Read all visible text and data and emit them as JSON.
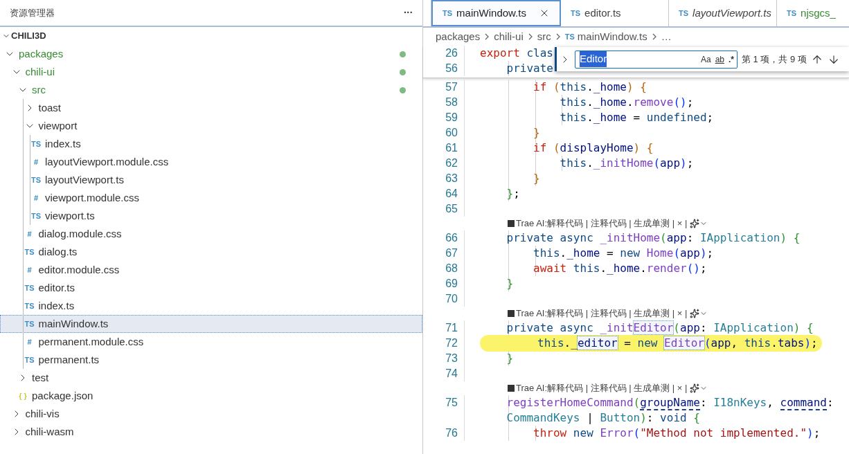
{
  "sidebar": {
    "title": "资源管理器",
    "more": "···",
    "root": {
      "name": "CHILI3D",
      "expanded": true
    },
    "tree": [
      {
        "name": "packages",
        "kind": "folder",
        "expanded": true,
        "untracked": true,
        "children": [
          {
            "name": "chili-ui",
            "kind": "folder",
            "expanded": true,
            "untracked": true,
            "children": [
              {
                "name": "src",
                "kind": "folder",
                "expanded": true,
                "untracked": true,
                "children": [
                  {
                    "name": "toast",
                    "kind": "folder",
                    "expanded": false,
                    "untracked": false
                  },
                  {
                    "name": "viewport",
                    "kind": "folder",
                    "expanded": true,
                    "untracked": false,
                    "children": [
                      {
                        "name": "index.ts",
                        "kind": "file",
                        "color": "#3f8fc4",
                        "icon": "TS",
                        "selected": false
                      },
                      {
                        "name": "layoutViewport.module.css",
                        "kind": "file",
                        "color": "#3f8fc4",
                        "icon": "#",
                        "selected": false
                      },
                      {
                        "name": "layoutViewport.ts",
                        "kind": "file",
                        "color": "#3f8fc4",
                        "icon": "TS",
                        "selected": false
                      },
                      {
                        "name": "viewport.module.css",
                        "kind": "file",
                        "color": "#3f8fc4",
                        "icon": "#",
                        "selected": false
                      },
                      {
                        "name": "viewport.ts",
                        "kind": "file",
                        "color": "#3f8fc4",
                        "icon": "TS",
                        "selected": false
                      }
                    ]
                  },
                  {
                    "name": "dialog.module.css",
                    "kind": "file",
                    "color": "#3f8fc4",
                    "icon": "#",
                    "selected": false
                  },
                  {
                    "name": "dialog.ts",
                    "kind": "file",
                    "color": "#3f8fc4",
                    "icon": "TS",
                    "selected": false
                  },
                  {
                    "name": "editor.module.css",
                    "kind": "file",
                    "color": "#3f8fc4",
                    "icon": "#",
                    "selected": false
                  },
                  {
                    "name": "editor.ts",
                    "kind": "file",
                    "color": "#3f8fc4",
                    "icon": "TS",
                    "selected": false
                  },
                  {
                    "name": "index.ts",
                    "kind": "file",
                    "color": "#3f8fc4",
                    "icon": "TS",
                    "selected": false
                  },
                  {
                    "name": "mainWindow.ts",
                    "kind": "file",
                    "color": "#3f8fc4",
                    "icon": "TS",
                    "selected": true
                  },
                  {
                    "name": "permanent.module.css",
                    "kind": "file",
                    "color": "#3f8fc4",
                    "icon": "#",
                    "selected": false
                  },
                  {
                    "name": "permanent.ts",
                    "kind": "file",
                    "color": "#3f8fc4",
                    "icon": "TS",
                    "selected": false
                  }
                ]
              },
              {
                "name": "test",
                "kind": "folder",
                "expanded": false,
                "untracked": false
              },
              {
                "name": "package.json",
                "kind": "file",
                "color": "#cbcb41",
                "icon": "{ }",
                "selected": false
              }
            ]
          },
          {
            "name": "chili-vis",
            "kind": "folder",
            "expanded": false,
            "untracked": false
          },
          {
            "name": "chili-wasm",
            "kind": "folder",
            "expanded": false,
            "untracked": false
          }
        ]
      }
    ]
  },
  "tabs": [
    {
      "label": "mainWindow.ts",
      "icon": "TS",
      "selected": true,
      "preview": false,
      "untracked": false
    },
    {
      "label": "editor.ts",
      "icon": "TS",
      "selected": false,
      "preview": false,
      "untracked": false
    },
    {
      "label": "layoutViewport.ts",
      "icon": "TS",
      "selected": false,
      "preview": true,
      "untracked": false
    },
    {
      "label": "njsgcs_",
      "icon": "TS",
      "selected": false,
      "preview": false,
      "untracked": true
    }
  ],
  "breadcrumbs": [
    {
      "label": "packages"
    },
    {
      "label": "chili-ui"
    },
    {
      "label": "src"
    },
    {
      "label": "mainWindow.ts",
      "icon": "TS"
    },
    {
      "label": "…"
    }
  ],
  "find": {
    "value": "Editor",
    "options": [
      "Aa",
      "ab",
      ".*"
    ],
    "result": "第 1 项，共 9 项"
  },
  "sticky": [
    {
      "number": "26",
      "tokens": [
        {
          "text": "export ",
          "kind": "kw"
        },
        {
          "text": "clas",
          "kind": "st"
        }
      ]
    },
    {
      "number": "56",
      "tokens": [
        {
          "text": "    private",
          "kind": "st"
        }
      ]
    }
  ],
  "lines": [
    {
      "kind": "code",
      "number": "57",
      "tokens": [
        {
          "text": "        if ",
          "kind": "kw"
        },
        {
          "text": "(",
          "kind": "b1"
        },
        {
          "text": "this",
          "kind": "st"
        },
        {
          "text": "."
        },
        {
          "text": "_home",
          "kind": "v"
        },
        {
          "text": ") {",
          "kind": "b1"
        }
      ]
    },
    {
      "kind": "code",
      "number": "58",
      "tokens": [
        {
          "text": "            this",
          "kind": "st"
        },
        {
          "text": "."
        },
        {
          "text": "_home",
          "kind": "v"
        },
        {
          "text": "."
        },
        {
          "text": "remove",
          "kind": "f"
        },
        {
          "text": "()",
          "kind": "b3"
        },
        {
          "text": ";"
        }
      ]
    },
    {
      "kind": "code",
      "number": "59",
      "tokens": [
        {
          "text": "            this",
          "kind": "st"
        },
        {
          "text": "."
        },
        {
          "text": "_home",
          "kind": "v"
        },
        {
          "text": " = "
        },
        {
          "text": "undefined",
          "kind": "st"
        },
        {
          "text": ";"
        }
      ]
    },
    {
      "kind": "code",
      "number": "60",
      "tokens": [
        {
          "text": "        }",
          "kind": "b1"
        }
      ]
    },
    {
      "kind": "code",
      "number": "61",
      "tokens": [
        {
          "text": "        if ",
          "kind": "kw"
        },
        {
          "text": "(",
          "kind": "b1"
        },
        {
          "text": "displayHome",
          "kind": "v"
        },
        {
          "text": ") {",
          "kind": "b1"
        }
      ]
    },
    {
      "kind": "code",
      "number": "62",
      "tokens": [
        {
          "text": "            this",
          "kind": "st"
        },
        {
          "text": "."
        },
        {
          "text": "_initHome",
          "kind": "f"
        },
        {
          "text": "(",
          "kind": "b3"
        },
        {
          "text": "app",
          "kind": "v"
        },
        {
          "text": ")",
          "kind": "b3"
        },
        {
          "text": ";"
        }
      ]
    },
    {
      "kind": "code",
      "number": "63",
      "tokens": [
        {
          "text": "        }",
          "kind": "b1"
        }
      ]
    },
    {
      "kind": "code",
      "number": "64",
      "tokens": [
        {
          "text": "    }",
          "kind": "b2"
        },
        {
          "text": ";"
        }
      ]
    },
    {
      "kind": "code",
      "number": "65"
    },
    {
      "kind": "lens",
      "text": "Trae AI:解释代码 | 注释代码 | 生成单测 | × |"
    },
    {
      "kind": "code",
      "number": "66",
      "tokens": [
        {
          "text": "    private async ",
          "kind": "st"
        },
        {
          "text": "_initHome",
          "kind": "f"
        },
        {
          "text": "(",
          "kind": "b2"
        },
        {
          "text": "app",
          "kind": "v"
        },
        {
          "text": ": "
        },
        {
          "text": "IApplication",
          "kind": "t"
        },
        {
          "text": ") {",
          "kind": "b2"
        }
      ]
    },
    {
      "kind": "code",
      "number": "67",
      "tokens": [
        {
          "text": "        this",
          "kind": "st"
        },
        {
          "text": "."
        },
        {
          "text": "_home",
          "kind": "v"
        },
        {
          "text": " = "
        },
        {
          "text": "new ",
          "kind": "st"
        },
        {
          "text": "Home",
          "kind": "f"
        },
        {
          "text": "(",
          "kind": "b3"
        },
        {
          "text": "app",
          "kind": "v"
        },
        {
          "text": ")",
          "kind": "b3"
        },
        {
          "text": ";"
        }
      ]
    },
    {
      "kind": "code",
      "number": "68",
      "tokens": [
        {
          "text": "        await ",
          "kind": "kw"
        },
        {
          "text": "this",
          "kind": "st"
        },
        {
          "text": "."
        },
        {
          "text": "_home",
          "kind": "v"
        },
        {
          "text": "."
        },
        {
          "text": "render",
          "kind": "f"
        },
        {
          "text": "()",
          "kind": "b3"
        },
        {
          "text": ";"
        }
      ]
    },
    {
      "kind": "code",
      "number": "69",
      "tokens": [
        {
          "text": "    }",
          "kind": "b2"
        }
      ]
    },
    {
      "kind": "code",
      "number": "70"
    },
    {
      "kind": "lens",
      "text": "Trae AI:解释代码 | 注释代码 | 生成单测 | × |"
    },
    {
      "kind": "code",
      "number": "71",
      "tokens": [
        {
          "text": "    private async ",
          "kind": "st"
        },
        {
          "text": "_init",
          "kind": "f"
        },
        {
          "text": "Editor",
          "kind": "f",
          "match": true
        },
        {
          "text": "(",
          "kind": "b2"
        },
        {
          "text": "app",
          "kind": "v"
        },
        {
          "text": ": "
        },
        {
          "text": "IApplication",
          "kind": "t"
        },
        {
          "text": ") {",
          "kind": "b2"
        }
      ]
    },
    {
      "kind": "code",
      "number": "72",
      "highlighted": true,
      "tokens": [
        {
          "text": "        this",
          "kind": "st"
        },
        {
          "text": "."
        },
        {
          "text": "_",
          "kind": "v"
        },
        {
          "text": "editor",
          "kind": "v",
          "match": true
        },
        {
          "text": " = "
        },
        {
          "text": "new ",
          "kind": "st"
        },
        {
          "text": "Editor",
          "kind": "f",
          "match": true
        },
        {
          "text": "(",
          "kind": "b3"
        },
        {
          "text": "app",
          "kind": "v"
        },
        {
          "text": ", "
        },
        {
          "text": "this",
          "kind": "st"
        },
        {
          "text": "."
        },
        {
          "text": "tabs",
          "kind": "v"
        },
        {
          "text": ")",
          "kind": "b3"
        },
        {
          "text": ";"
        }
      ]
    },
    {
      "kind": "code",
      "number": "73",
      "tokens": [
        {
          "text": "    }",
          "kind": "b2"
        }
      ]
    },
    {
      "kind": "code",
      "number": "74"
    },
    {
      "kind": "lens",
      "text": "Trae AI:解释代码 | 注释代码 | 生成单测 | × |"
    },
    {
      "kind": "code",
      "number": "75",
      "tokens": [
        {
          "text": "    registerHomeCommand",
          "kind": "f"
        },
        {
          "text": "(",
          "kind": "b2"
        },
        {
          "text": "groupName",
          "kind": "v",
          "warn": true
        },
        {
          "text": ": "
        },
        {
          "text": "I18nKeys",
          "kind": "t"
        },
        {
          "text": ", "
        },
        {
          "text": "command",
          "kind": "v",
          "warn": true
        },
        {
          "text": ":"
        }
      ]
    },
    {
      "kind": "wrap",
      "tokens": [
        {
          "text": "    CommandKeys",
          "kind": "t"
        },
        {
          "text": " | "
        },
        {
          "text": "Button",
          "kind": "t"
        },
        {
          "text": ")",
          "kind": "b2"
        },
        {
          "text": ": "
        },
        {
          "text": "void ",
          "kind": "st"
        },
        {
          "text": "{",
          "kind": "b2"
        }
      ]
    },
    {
      "kind": "code",
      "number": "76",
      "tokens": [
        {
          "text": "        throw ",
          "kind": "kw"
        },
        {
          "text": "new ",
          "kind": "st"
        },
        {
          "text": "Error",
          "kind": "f"
        },
        {
          "text": "(",
          "kind": "b3"
        },
        {
          "text": "\"Method not implemented.\"",
          "kind": "s"
        },
        {
          "text": ")",
          "kind": "b3"
        },
        {
          "text": ";"
        }
      ]
    }
  ]
}
